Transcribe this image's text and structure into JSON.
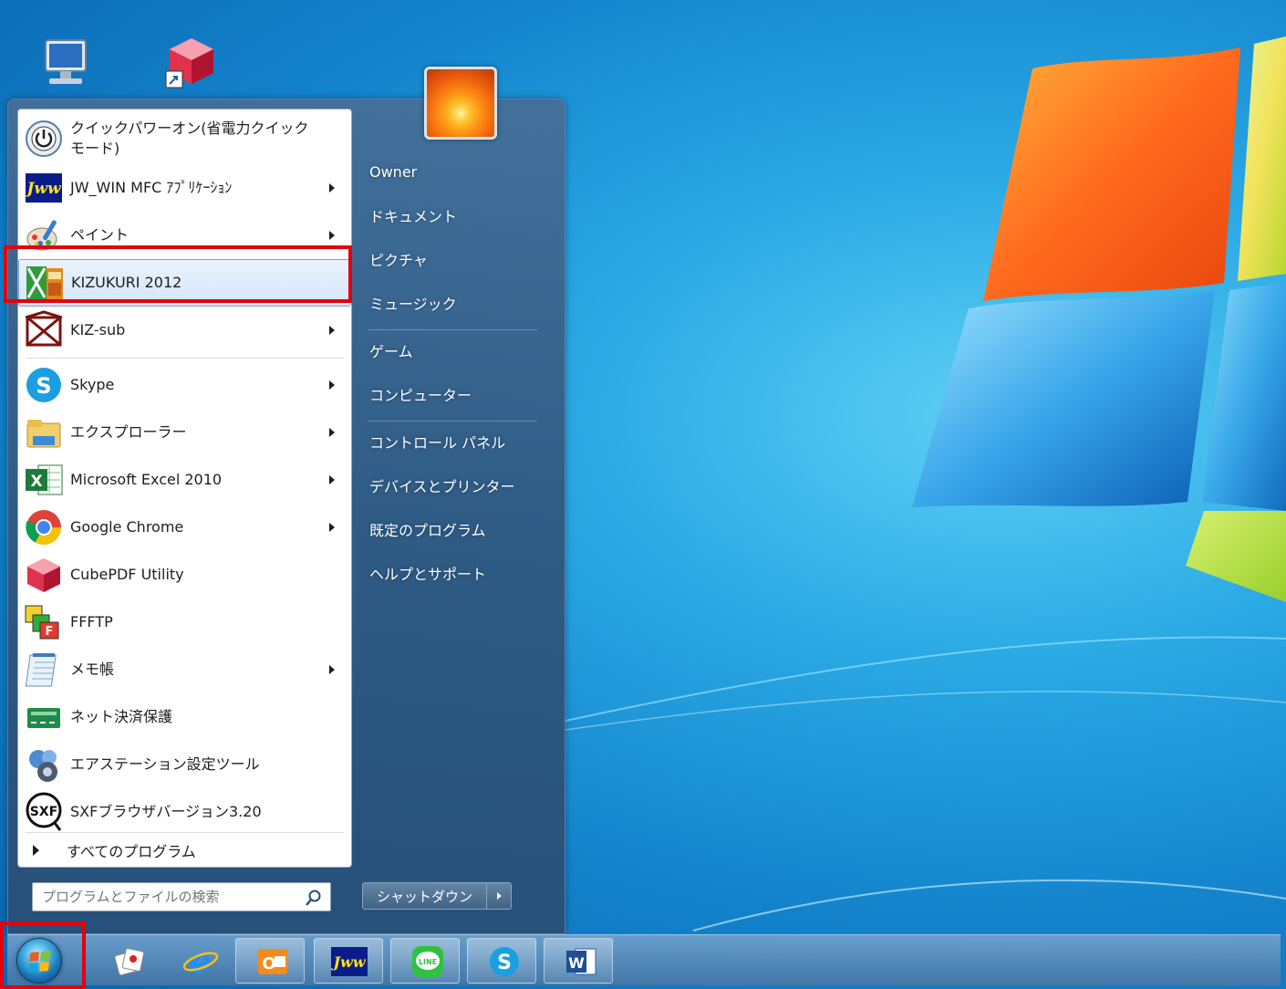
{
  "desktop": {
    "icons": [
      "computer-icon",
      "cubepdf-shortcut-icon"
    ]
  },
  "start_menu": {
    "programs": [
      {
        "label": "クイックパワーオン(省電力クイック\nモード)",
        "icon": "power-icon",
        "submenu": false
      },
      {
        "label": "JW_WIN MFC ｱﾌﾟﾘｹｰｼｮﾝ",
        "icon": "jww-icon",
        "submenu": true
      },
      {
        "label": "ペイント",
        "icon": "paint-icon",
        "submenu": true
      },
      {
        "label": "KIZUKURI 2012",
        "icon": "kizukuri-icon",
        "submenu": false,
        "highlighted": true
      },
      {
        "label": "KIZ-sub",
        "icon": "kiz-sub-icon",
        "submenu": true
      },
      {
        "label": "Skype",
        "icon": "skype-icon",
        "submenu": true
      },
      {
        "label": "エクスプローラー",
        "icon": "explorer-icon",
        "submenu": true
      },
      {
        "label": "Microsoft Excel 2010",
        "icon": "excel-icon",
        "submenu": true
      },
      {
        "label": "Google Chrome",
        "icon": "chrome-icon",
        "submenu": true
      },
      {
        "label": "CubePDF Utility",
        "icon": "cubepdf-icon",
        "submenu": false
      },
      {
        "label": "FFFTP",
        "icon": "ffftp-icon",
        "submenu": false
      },
      {
        "label": "メモ帳",
        "icon": "notepad-icon",
        "submenu": true
      },
      {
        "label": "ネット決済保護",
        "icon": "net-payment-icon",
        "submenu": false
      },
      {
        "label": "エアステーション設定ツール",
        "icon": "airstation-icon",
        "submenu": false
      },
      {
        "label": "SXFブラウザバージョン3.20",
        "icon": "sxf-icon",
        "submenu": false
      }
    ],
    "all_programs": "すべてのプログラム",
    "search_placeholder": "プログラムとファイルの検索",
    "right_items": [
      "Owner",
      "ドキュメント",
      "ピクチャ",
      "ミュージック",
      "ゲーム",
      "コンピューター",
      "コントロール パネル",
      "デバイスとプリンター",
      "既定のプログラム",
      "ヘルプとサポート"
    ],
    "shutdown_label": "シャットダウン"
  },
  "taskbar": {
    "items": [
      "start-orb",
      "games-icon",
      "internet-explorer-icon",
      "outlook-icon",
      "jww-icon",
      "line-icon",
      "skype-icon",
      "word-icon"
    ],
    "line_label": "LINE"
  },
  "colors": {
    "highlight_border": "#e3000f",
    "desktop_blue": "#1383cc"
  }
}
